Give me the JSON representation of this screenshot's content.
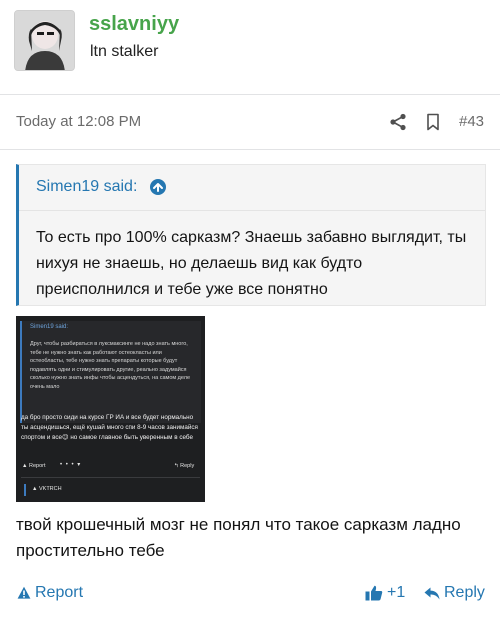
{
  "user": {
    "username": "sslavniyy",
    "title": "ltn stalker",
    "avatar_icon": "avatar-image"
  },
  "post": {
    "date": "Today at 12:08 PM",
    "number": "#43",
    "share_icon": "share-icon",
    "bookmark_icon": "bookmark-icon"
  },
  "quote": {
    "author": "Simen19 said:",
    "text": "То есть про 100% сарказм? Знаешь забавно выглядит, ты нихуя не знаешь, но делаешь вид как будто преисполнился и тебе уже все понятно"
  },
  "screenshot": {
    "quote_author": "Simen19 said:",
    "quote_text": "Друг, чтобы разбираться в луксмаксинге не надо знать много, тебе не нужно знать как работают остеокласты или остеобласты, тебе нужно знать препараты которые будут подавлять одни и стимулировать другие, реально задумайся сколько нужно знать инфы чтобы асцендуться, на самом деле очень мало",
    "text": "да бро просто сиди на курсе ГР ИА и все будет нормально ты асцендишься, ещё кушай много спи 8-9 часов занимайся спортом и все😉 но самое главное быть уверенным в себе",
    "report": "Report",
    "dots": "• • • ▾",
    "reply": "Reply",
    "reaction": "VKTRCH"
  },
  "reply_text": "твой крошечный мозг не понял что такое сарказм ладно простительно тебе",
  "actions": {
    "report": "Report",
    "like_count": "+1",
    "reply": "Reply"
  },
  "colors": {
    "accent": "#2577b1",
    "username": "#47a44b"
  }
}
